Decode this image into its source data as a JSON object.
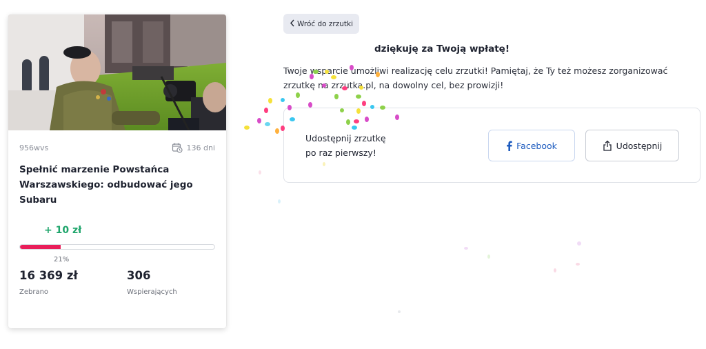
{
  "campaign": {
    "author": "956wvs",
    "days_left": "136 dni",
    "title": "Spełnić marzenie Powstańca Warszawskiego: odbudować jego Subaru",
    "donation_added": "+ 10 zł",
    "progress_percent": 21,
    "progress_label": "21%",
    "raised_value": "16 369 zł",
    "raised_label": "Zebrano",
    "supporters_value": "306",
    "supporters_label": "Wspierających"
  },
  "thankyou": {
    "back_label": "Wróć do zrzutki",
    "heading": "dziękuję za Twoją wpłatę!",
    "message": "Twoje wsparcie umożliwi realizację celu zrzutki! Pamiętaj, że Ty też możesz zorganizować zrzutkę na zrzutka.pl, na dowolny cel, bez prowizji!"
  },
  "share": {
    "line1": "Udostępnij zrzutkę",
    "line2": "po raz pierwszy!",
    "facebook_label": "Facebook",
    "share_label": "Udostępnij"
  },
  "colors": {
    "accent_green": "#1ea56b",
    "progress_pink": "#e91e5a",
    "facebook_blue": "#1d5bbf"
  },
  "icons": {
    "back": "chevron-left-icon",
    "calendar": "calendar-clock-icon",
    "facebook": "facebook-icon",
    "share": "share-icon"
  }
}
